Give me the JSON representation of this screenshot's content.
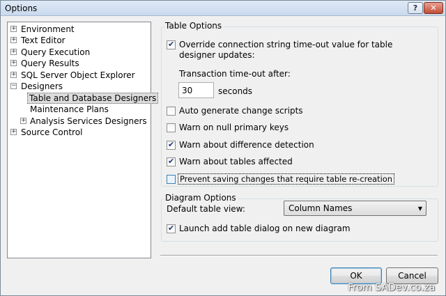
{
  "window": {
    "title": "Options",
    "help_label": "?",
    "close_label": "✕"
  },
  "tree": {
    "items": [
      {
        "label": "Environment",
        "expander": "+"
      },
      {
        "label": "Text Editor",
        "expander": "+"
      },
      {
        "label": "Query Execution",
        "expander": "+"
      },
      {
        "label": "Query Results",
        "expander": "+"
      },
      {
        "label": "SQL Server Object Explorer",
        "expander": "+"
      },
      {
        "label": "Designers",
        "expander": "−"
      },
      {
        "label": "Table and Database Designers",
        "expander": ""
      },
      {
        "label": "Maintenance Plans",
        "expander": ""
      },
      {
        "label": "Analysis Services Designers",
        "expander": "+"
      },
      {
        "label": "Source Control",
        "expander": "+"
      }
    ]
  },
  "table_options": {
    "title": "Table Options",
    "override": {
      "label_line1": "Override connection string time-out value for table",
      "label_line2": "designer updates:",
      "checked": true
    },
    "timeout_label": "Transaction time-out after:",
    "timeout_value": "30",
    "timeout_unit": "seconds",
    "auto_generate": {
      "label": "Auto generate change scripts",
      "checked": false
    },
    "warn_null": {
      "label": "Warn on null primary keys",
      "checked": false
    },
    "warn_difference": {
      "label": "Warn about difference detection",
      "checked": true
    },
    "warn_tables": {
      "label": "Warn about tables affected",
      "checked": true
    },
    "prevent_saving": {
      "label": "Prevent saving changes that require table re-creation",
      "checked": false
    }
  },
  "diagram_options": {
    "title": "Diagram Options",
    "default_view_label": "Default table view:",
    "default_view_value": "Column Names",
    "launch_add": {
      "label": "Launch add table dialog on new diagram",
      "checked": true
    }
  },
  "buttons": {
    "ok": "OK",
    "cancel": "Cancel"
  },
  "watermark": "From SADev.co.za"
}
